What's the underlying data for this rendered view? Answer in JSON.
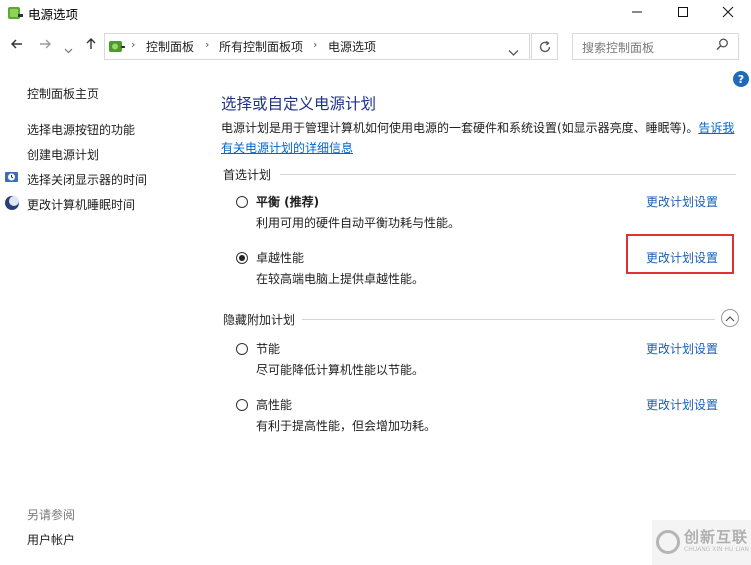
{
  "window": {
    "title": "电源选项"
  },
  "address": {
    "segments": [
      "控制面板",
      "所有控制面板项",
      "电源选项"
    ]
  },
  "search": {
    "placeholder": "搜索控制面板"
  },
  "sidebar": {
    "home": "控制面板主页",
    "links": [
      "选择电源按钮的功能",
      "创建电源计划",
      "选择关闭显示器的时间",
      "更改计算机睡眠时间"
    ],
    "see_also": "另请参阅",
    "see_also_links": [
      "用户帐户"
    ]
  },
  "main": {
    "heading": "选择或自定义电源计划",
    "description": "电源计划是用于管理计算机如何使用电源的一套硬件和系统设置(如显示器亮度、睡眠等)。",
    "description_link": "告诉我有关电源计划的详细信息",
    "preferred_label": "首选计划",
    "hidden_label": "隐藏附加计划",
    "change_link": "更改计划设置",
    "plans": [
      {
        "name": "平衡 (推荐)",
        "desc": "利用可用的硬件自动平衡功耗与性能。",
        "selected": false
      },
      {
        "name": "卓越性能",
        "desc": "在较高端电脑上提供卓越性能。",
        "selected": true
      },
      {
        "name": "节能",
        "desc": "尽可能降低计算机性能以节能。",
        "selected": false
      },
      {
        "name": "高性能",
        "desc": "有利于提高性能，但会增加功耗。",
        "selected": false
      }
    ]
  },
  "watermark": {
    "text": "创新互联",
    "sub": "CHUANG XIN HU LIAN"
  },
  "colors": {
    "heading": "#1e3287",
    "link": "#1a5fb4",
    "highlight": "#e03232"
  }
}
